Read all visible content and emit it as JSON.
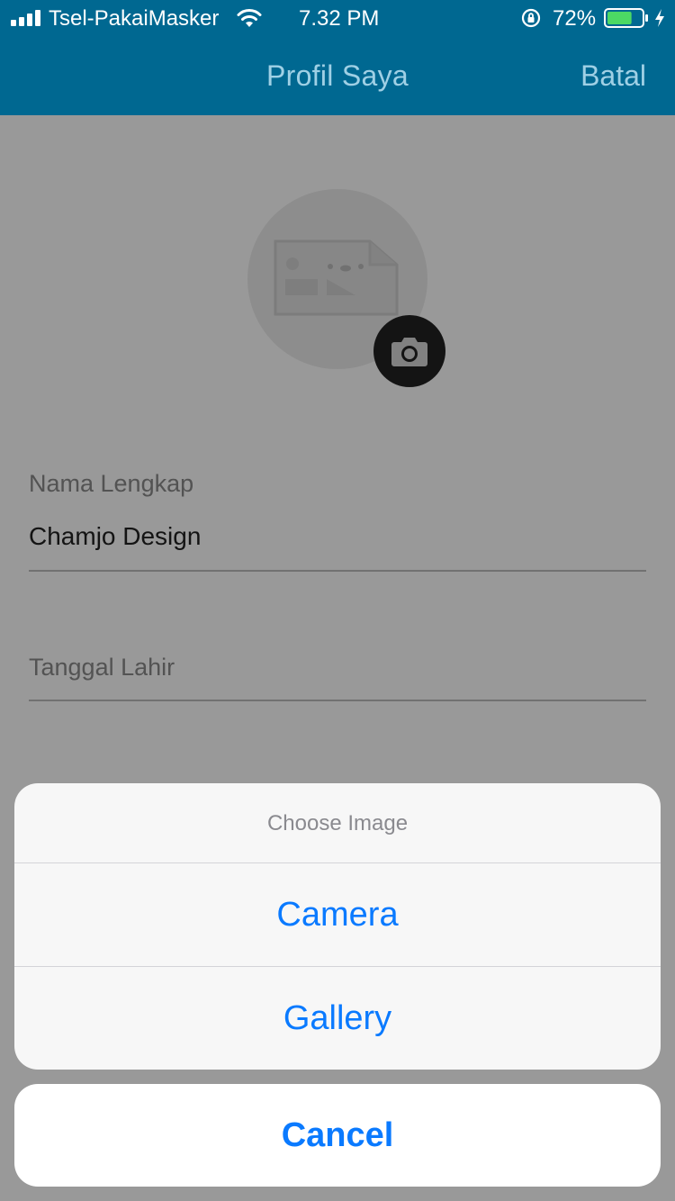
{
  "status_bar": {
    "carrier": "Tsel-PakaiMasker",
    "time": "7.32 PM",
    "battery_percent": "72%",
    "battery_level": 0.72,
    "battery_color": "#4cd964"
  },
  "nav": {
    "title": "Profil Saya",
    "cancel_label": "Batal",
    "background_color": "#006891"
  },
  "profile": {
    "avatar_icon": "image-placeholder-icon",
    "change_photo_icon": "camera-icon",
    "fields": [
      {
        "label": "Nama Lengkap",
        "value": "Chamjo Design"
      },
      {
        "label": "Tanggal Lahir",
        "value": ""
      }
    ]
  },
  "action_sheet": {
    "title": "Choose Image",
    "options": [
      "Camera",
      "Gallery"
    ],
    "cancel_label": "Cancel",
    "accent_color": "#0a7aff"
  }
}
